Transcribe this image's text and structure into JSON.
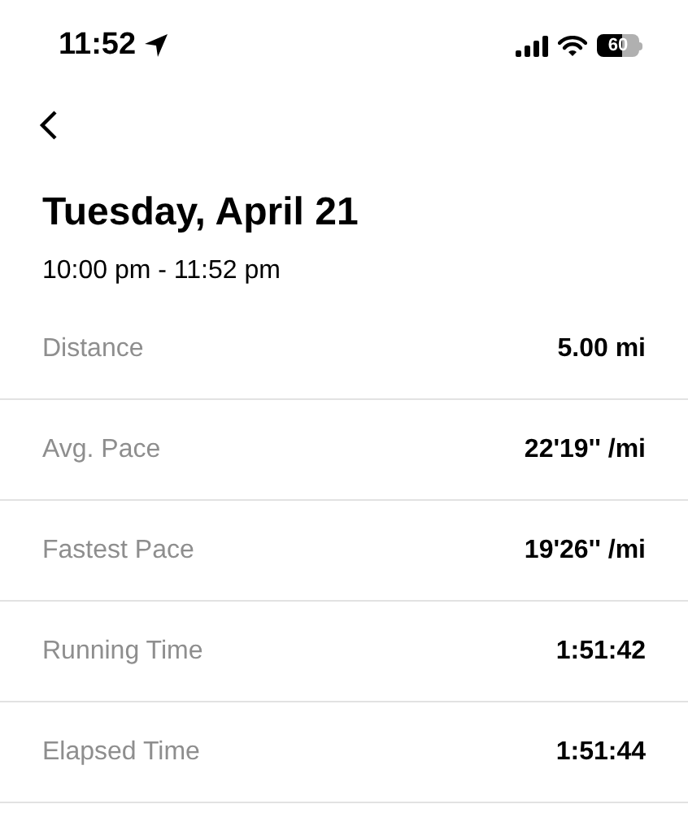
{
  "status_bar": {
    "time": "11:52",
    "battery": "60"
  },
  "title": "Tuesday, April 21",
  "time_range": "10:00 pm - 11:52 pm",
  "stats": [
    {
      "label": "Distance",
      "value": "5.00 mi"
    },
    {
      "label": "Avg. Pace",
      "value": "22'19'' /mi"
    },
    {
      "label": "Fastest Pace",
      "value": "19'26'' /mi"
    },
    {
      "label": "Running Time",
      "value": "1:51:42"
    },
    {
      "label": "Elapsed Time",
      "value": "1:51:44"
    }
  ]
}
